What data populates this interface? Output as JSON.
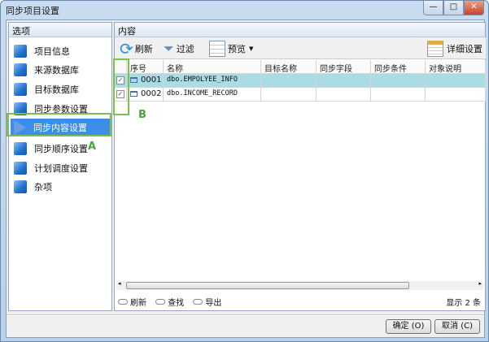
{
  "window": {
    "title": "同步项目设置",
    "minimize": "—",
    "maximize": "□",
    "close": "✕"
  },
  "left": {
    "header": "选项",
    "items": [
      {
        "label": "项目信息"
      },
      {
        "label": "来源数据库"
      },
      {
        "label": "目标数据库"
      },
      {
        "label": "同步参数设置"
      },
      {
        "label": "同步内容设置",
        "selected": true
      },
      {
        "label": "同步顺序设置"
      },
      {
        "label": "计划调度设置"
      },
      {
        "label": "杂项"
      }
    ]
  },
  "right": {
    "header": "内容",
    "toolbar": {
      "refresh": "刷新",
      "filter": "过滤",
      "preview": "预览",
      "detail": "详细设置"
    },
    "columns": [
      "序号",
      "名称",
      "目标名称",
      "同步字段",
      "同步条件",
      "对象说明"
    ],
    "rows": [
      {
        "checked": true,
        "no": "0001",
        "name": "dbo.EMPOLYEE_INFO",
        "selected": true
      },
      {
        "checked": true,
        "no": "0002",
        "name": "dbo.INCOME_RECORD"
      }
    ],
    "footer": {
      "refresh": "刷新",
      "find": "查找",
      "export": "导出",
      "count": "显示 2 条"
    }
  },
  "buttons": {
    "ok": "确定 (O)",
    "cancel": "取消 (C)"
  },
  "annotations": {
    "a": "A",
    "b": "B"
  },
  "colors": {
    "selection": "#3d8ee8",
    "row_highlight": "#a9dde3",
    "annotation": "#7cc04a"
  }
}
